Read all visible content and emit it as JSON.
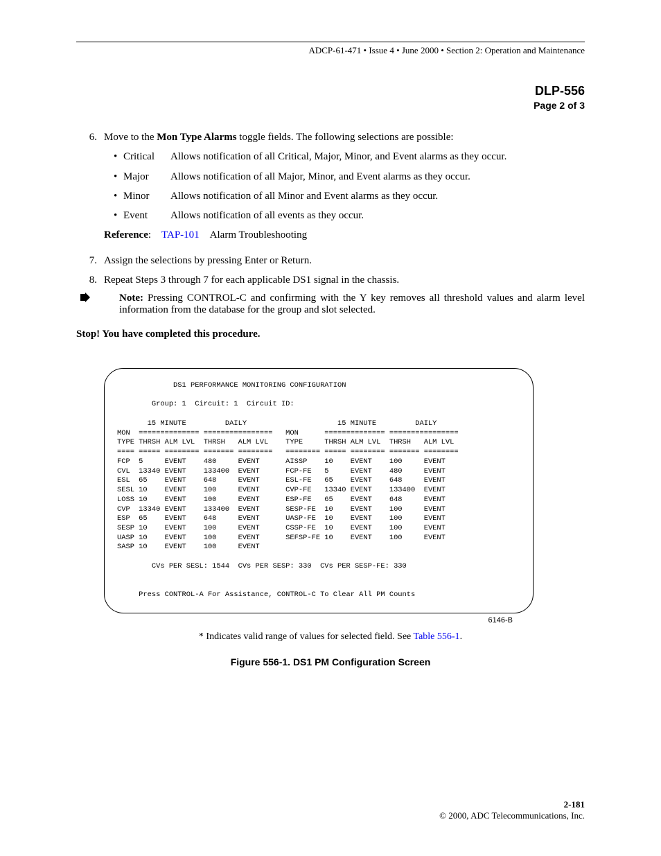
{
  "header": "ADCP-61-471 • Issue 4 • June 2000 • Section 2: Operation and Maintenance",
  "dlp": "DLP-556",
  "page_label": "Page 2 of 3",
  "step6_num": "6.",
  "step6_prefix": "Move to the ",
  "step6_bold": "Mon Type Alarms",
  "step6_suffix": " toggle fields. The following selections are possible:",
  "bullets": [
    {
      "label": "Critical",
      "desc": "Allows notification of all Critical, Major, Minor, and Event alarms as they occur."
    },
    {
      "label": "Major",
      "desc": "Allows notification of all Major, Minor, and Event alarms as they occur."
    },
    {
      "label": "Minor",
      "desc": "Allows notification of all Minor and Event alarms as they occur."
    },
    {
      "label": "Event",
      "desc": "Allows notification of all events as they occur."
    }
  ],
  "ref_label": "Reference",
  "ref_link": "TAP-101",
  "ref_text": "Alarm Troubleshooting",
  "step7_num": "7.",
  "step7_text": "Assign the selections by pressing Enter or Return.",
  "step8_num": "8.",
  "step8_text": "Repeat Steps 3 through 7 for each applicable DS1 signal in the chassis.",
  "note_label": "Note:",
  "note_text": " Pressing CONTROL-C and confirming with the Y key removes all threshold values and alarm level information from the database for the group and slot selected.",
  "stop_text": "Stop! You have completed this procedure.",
  "terminal": "             DS1 PERFORMANCE MONITORING CONFIGURATION\n\n        Group: 1  Circuit: 1  Circuit ID:\n\n       15 MINUTE         DAILY                     15 MINUTE         DAILY\nMON  ============== ================   MON      ============== ================\nTYPE THRSH ALM LVL  THRSH   ALM LVL    TYPE     THRSH ALM LVL  THRSH   ALM LVL\n==== ===== ======== ======= ========   ======== ===== ======== ======= ========\nFCP  5     EVENT    480     EVENT      AISSP    10    EVENT    100     EVENT\nCVL  13340 EVENT    133400  EVENT      FCP-FE   5     EVENT    480     EVENT\nESL  65    EVENT    648     EVENT      ESL-FE   65    EVENT    648     EVENT\nSESL 10    EVENT    100     EVENT      CVP-FE   13340 EVENT    133400  EVENT\nLOSS 10    EVENT    100     EVENT      ESP-FE   65    EVENT    648     EVENT\nCVP  13340 EVENT    133400  EVENT      SESP-FE  10    EVENT    100     EVENT\nESP  65    EVENT    648     EVENT      UASP-FE  10    EVENT    100     EVENT\nSESP 10    EVENT    100     EVENT      CSSP-FE  10    EVENT    100     EVENT\nUASP 10    EVENT    100     EVENT      SEFSP-FE 10    EVENT    100     EVENT\nSASP 10    EVENT    100     EVENT\n\n        CVs PER SESL: 1544  CVs PER SESP: 330  CVs PER SESP-FE: 330\n\n\n     Press CONTROL-A For Assistance, CONTROL-C To Clear All PM Counts",
  "terminal_id": "6146-B",
  "fig_note_prefix": "* Indicates valid range of values for selected field. See ",
  "fig_note_link": "Table 556-1",
  "fig_note_suffix": ".",
  "fig_caption": "Figure 556-1. DS1 PM Configuration Screen",
  "footer_page": "2-181",
  "footer_copy": "© 2000, ADC Telecommunications, Inc.",
  "chart_data": {
    "type": "table",
    "title": "DS1 PERFORMANCE MONITORING CONFIGURATION",
    "group": 1,
    "circuit": 1,
    "circuit_id": "",
    "columns": [
      "MON TYPE",
      "15 MINUTE THRSH",
      "15 MINUTE ALM LVL",
      "DAILY THRSH",
      "DAILY ALM LVL"
    ],
    "left_rows": [
      {
        "type": "FCP",
        "thrsh_15": 5,
        "alm_15": "EVENT",
        "thrsh_daily": 480,
        "alm_daily": "EVENT"
      },
      {
        "type": "CVL",
        "thrsh_15": 13340,
        "alm_15": "EVENT",
        "thrsh_daily": 133400,
        "alm_daily": "EVENT"
      },
      {
        "type": "ESL",
        "thrsh_15": 65,
        "alm_15": "EVENT",
        "thrsh_daily": 648,
        "alm_daily": "EVENT"
      },
      {
        "type": "SESL",
        "thrsh_15": 10,
        "alm_15": "EVENT",
        "thrsh_daily": 100,
        "alm_daily": "EVENT"
      },
      {
        "type": "LOSS",
        "thrsh_15": 10,
        "alm_15": "EVENT",
        "thrsh_daily": 100,
        "alm_daily": "EVENT"
      },
      {
        "type": "CVP",
        "thrsh_15": 13340,
        "alm_15": "EVENT",
        "thrsh_daily": 133400,
        "alm_daily": "EVENT"
      },
      {
        "type": "ESP",
        "thrsh_15": 65,
        "alm_15": "EVENT",
        "thrsh_daily": 648,
        "alm_daily": "EVENT"
      },
      {
        "type": "SESP",
        "thrsh_15": 10,
        "alm_15": "EVENT",
        "thrsh_daily": 100,
        "alm_daily": "EVENT"
      },
      {
        "type": "UASP",
        "thrsh_15": 10,
        "alm_15": "EVENT",
        "thrsh_daily": 100,
        "alm_daily": "EVENT"
      },
      {
        "type": "SASP",
        "thrsh_15": 10,
        "alm_15": "EVENT",
        "thrsh_daily": 100,
        "alm_daily": "EVENT"
      }
    ],
    "right_rows": [
      {
        "type": "AISSP",
        "thrsh_15": 10,
        "alm_15": "EVENT",
        "thrsh_daily": 100,
        "alm_daily": "EVENT"
      },
      {
        "type": "FCP-FE",
        "thrsh_15": 5,
        "alm_15": "EVENT",
        "thrsh_daily": 480,
        "alm_daily": "EVENT"
      },
      {
        "type": "ESL-FE",
        "thrsh_15": 65,
        "alm_15": "EVENT",
        "thrsh_daily": 648,
        "alm_daily": "EVENT"
      },
      {
        "type": "CVP-FE",
        "thrsh_15": 13340,
        "alm_15": "EVENT",
        "thrsh_daily": 133400,
        "alm_daily": "EVENT"
      },
      {
        "type": "ESP-FE",
        "thrsh_15": 65,
        "alm_15": "EVENT",
        "thrsh_daily": 648,
        "alm_daily": "EVENT"
      },
      {
        "type": "SESP-FE",
        "thrsh_15": 10,
        "alm_15": "EVENT",
        "thrsh_daily": 100,
        "alm_daily": "EVENT"
      },
      {
        "type": "UASP-FE",
        "thrsh_15": 10,
        "alm_15": "EVENT",
        "thrsh_daily": 100,
        "alm_daily": "EVENT"
      },
      {
        "type": "CSSP-FE",
        "thrsh_15": 10,
        "alm_15": "EVENT",
        "thrsh_daily": 100,
        "alm_daily": "EVENT"
      },
      {
        "type": "SEFSP-FE",
        "thrsh_15": 10,
        "alm_15": "EVENT",
        "thrsh_daily": 100,
        "alm_daily": "EVENT"
      }
    ],
    "cvs_per_sesl": 1544,
    "cvs_per_sesp": 330,
    "cvs_per_sesp_fe": 330,
    "footer_msg": "Press CONTROL-A For Assistance, CONTROL-C To Clear All PM Counts"
  }
}
